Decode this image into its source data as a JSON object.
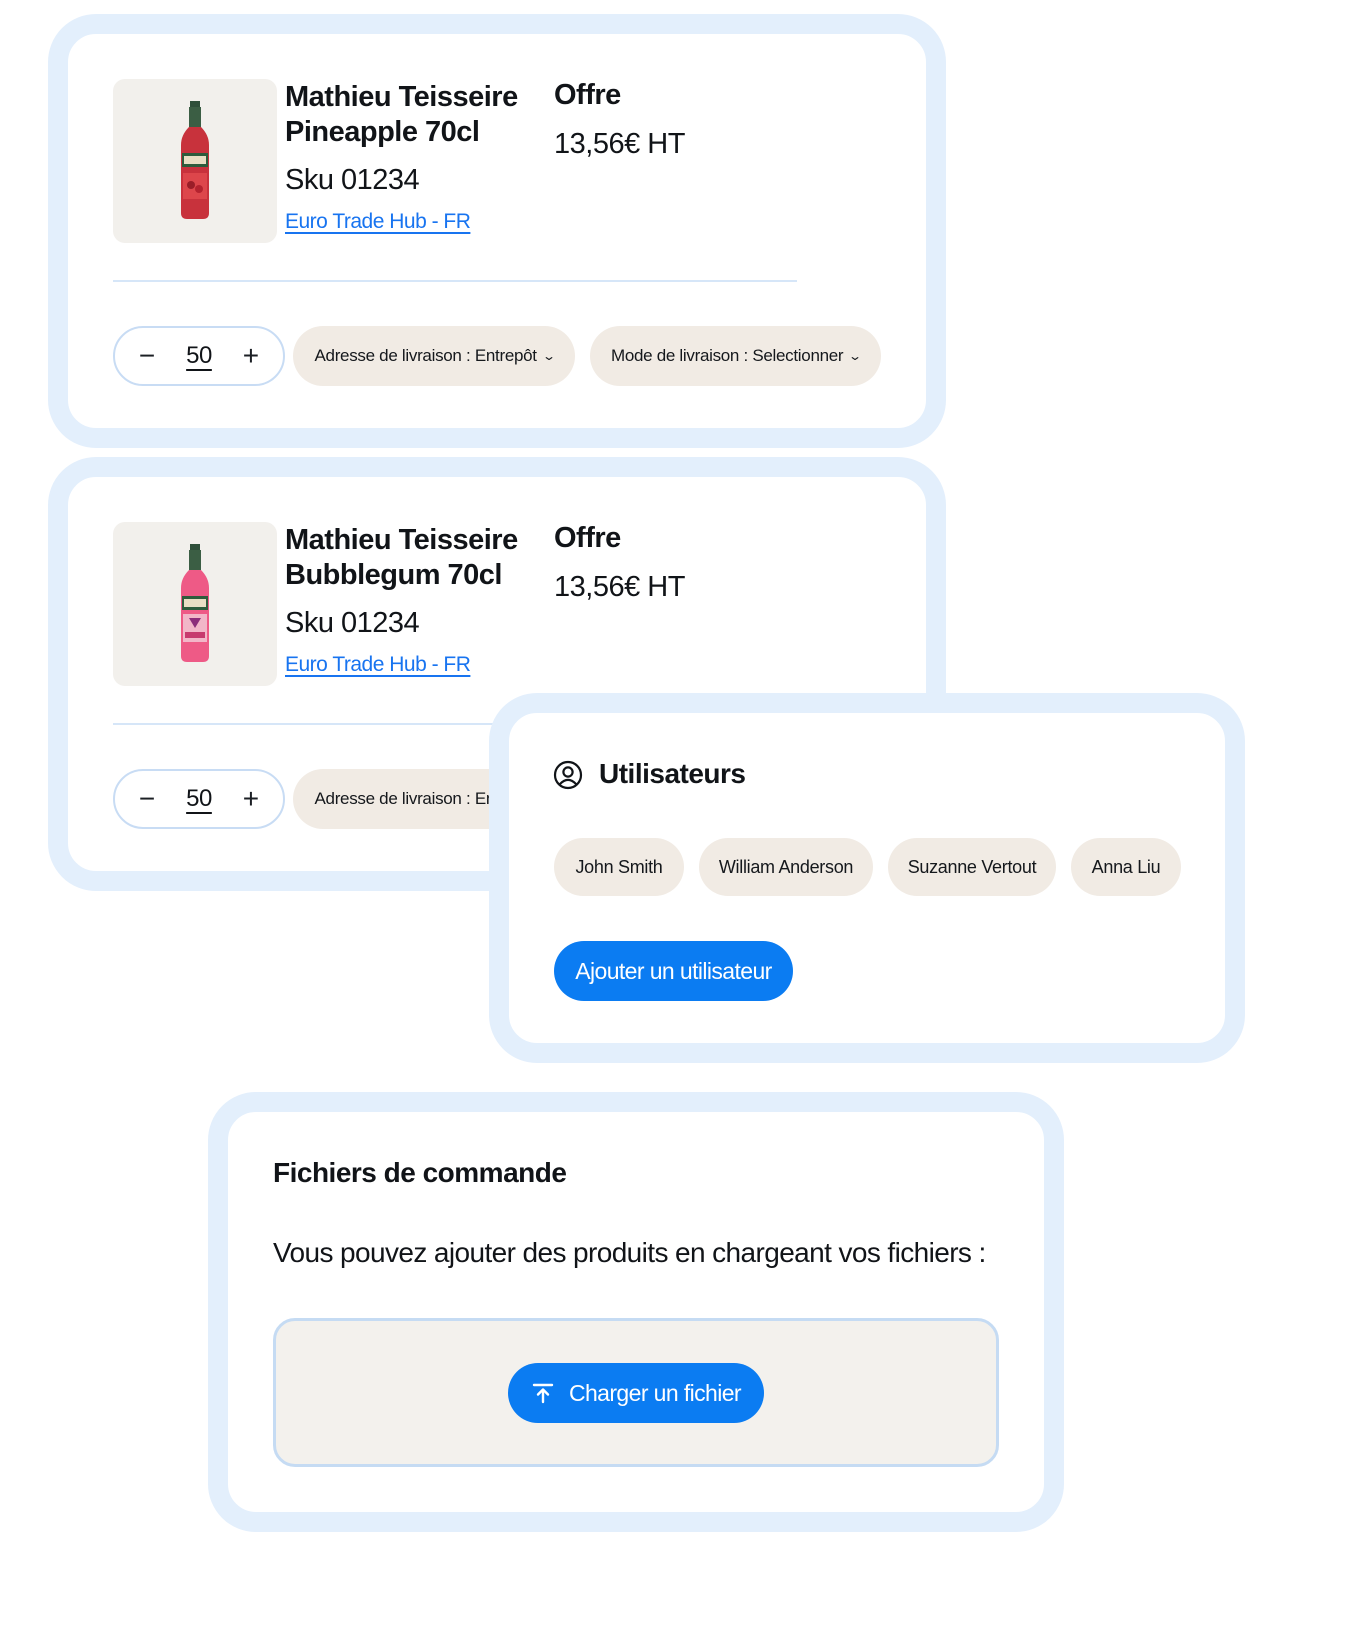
{
  "products": [
    {
      "name_line1": "Mathieu Teisseire",
      "name_line2": "Pineapple 70cl",
      "sku": "Sku 01234",
      "seller": "Euro Trade Hub - FR",
      "offer_label": "Offre",
      "price": "13,56€ HT",
      "quantity": "50",
      "delivery_address": "Adresse de livraison : Entrepôt",
      "delivery_mode": "Mode de livraison : Selectionner",
      "bottle_color": "#c8323c"
    },
    {
      "name_line1": "Mathieu Teisseire",
      "name_line2": "Bubblegum 70cl",
      "sku": "Sku 01234",
      "seller": "Euro Trade Hub - FR",
      "offer_label": "Offre",
      "price": "13,56€ HT",
      "quantity": "50",
      "delivery_address": "Adresse de livraison : Entrepôt",
      "bottle_color": "#ee5a86"
    }
  ],
  "stepper": {
    "minus": "−",
    "plus": "+"
  },
  "users": {
    "title": "Utilisateurs",
    "icon": "user-circle-icon",
    "names": [
      "John Smith",
      "William Anderson",
      "Suzanne Vertout",
      "Anna Liu"
    ],
    "add_button": "Ajouter un utilisateur"
  },
  "files": {
    "title": "Fichiers de commande",
    "description": "Vous pouvez ajouter des produits en chargeant vos fichiers :",
    "upload_button": "Charger un fichier",
    "upload_icon": "upload-icon"
  },
  "colors": {
    "accent": "#0b7cf2",
    "card_border": "#e3effc",
    "pill_bg": "#f1ebe4",
    "link": "#1874f0"
  }
}
